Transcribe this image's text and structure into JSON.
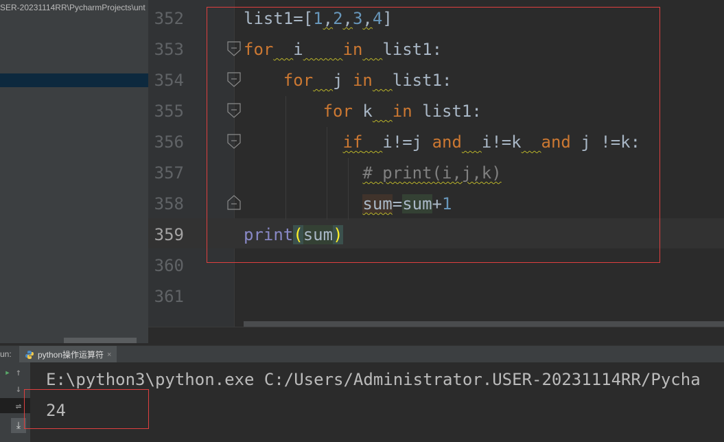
{
  "project": {
    "path": "SER-20231114RR\\PycharmProjects\\unt"
  },
  "editor": {
    "line_numbers": [
      "352",
      "353",
      "354",
      "355",
      "356",
      "357",
      "358",
      "359",
      "360",
      "361"
    ],
    "current_line": "359",
    "lines": [
      {
        "tokens": [
          [
            "list1=[",
            "ident"
          ],
          [
            "1",
            "num"
          ],
          [
            ",",
            "ident squig"
          ],
          [
            "2",
            "num"
          ],
          [
            ",",
            "ident squig"
          ],
          [
            "3",
            "num"
          ],
          [
            ",",
            "ident squig"
          ],
          [
            "4",
            "num"
          ],
          [
            "]",
            "ident"
          ]
        ]
      },
      {
        "tokens": [
          [
            "for",
            "kw"
          ],
          [
            "  ",
            "squig"
          ],
          [
            "i",
            "ident"
          ],
          [
            "    ",
            "squig"
          ],
          [
            "in",
            "kw"
          ],
          [
            "  ",
            "squig"
          ],
          [
            "list1:",
            "ident"
          ]
        ]
      },
      {
        "tokens": [
          [
            "    ",
            ""
          ],
          [
            "for",
            "kw"
          ],
          [
            "  ",
            "squig"
          ],
          [
            "j ",
            "ident"
          ],
          [
            "in",
            "kw"
          ],
          [
            "  ",
            "squig"
          ],
          [
            "list1:",
            "ident"
          ]
        ]
      },
      {
        "tokens": [
          [
            "        ",
            ""
          ],
          [
            "for",
            "kw"
          ],
          [
            " k",
            "ident"
          ],
          [
            "  ",
            "squig"
          ],
          [
            "in",
            "kw"
          ],
          [
            " list1:",
            "ident"
          ]
        ]
      },
      {
        "tokens": [
          [
            "          ",
            ""
          ],
          [
            "if",
            "kw squig"
          ],
          [
            "  ",
            "squig"
          ],
          [
            "i!=j ",
            "ident"
          ],
          [
            "and",
            "kw"
          ],
          [
            "  ",
            "squig"
          ],
          [
            "i!=k",
            "ident"
          ],
          [
            "  ",
            "squig"
          ],
          [
            "and",
            "kw"
          ],
          [
            " j !=k:",
            "ident"
          ]
        ]
      },
      {
        "tokens": [
          [
            "            ",
            ""
          ],
          [
            "# print(i,j,k)",
            "cmt squig"
          ]
        ]
      },
      {
        "tokens": [
          [
            "            ",
            ""
          ],
          [
            "sum",
            "ident squig hl-write"
          ],
          [
            "=",
            "ident"
          ],
          [
            "sum",
            "ident hl-read"
          ],
          [
            "+",
            "ident"
          ],
          [
            "1",
            "num"
          ]
        ]
      },
      {
        "tokens": [
          [
            "print",
            "builtin"
          ],
          [
            "(",
            "brace"
          ],
          [
            "sum",
            "ident hl-read"
          ],
          [
            ")",
            "brace"
          ]
        ]
      },
      {
        "tokens": []
      },
      {
        "tokens": []
      }
    ]
  },
  "run": {
    "label": "un:",
    "tab_title": "python操作运算符",
    "tab_close": "×",
    "console": [
      "E:\\python3\\python.exe C:/Users/Administrator.USER-20231114RR/Pycha",
      "24"
    ]
  },
  "icons": {
    "fold": "fold-marker-icon",
    "python": "python-icon",
    "run_up": "arrow-up-icon",
    "run_down": "arrow-down-icon",
    "wrap": "soft-wrap-icon",
    "scroll_end": "scroll-to-end-icon"
  },
  "colors": {
    "annotation": "#e04040",
    "keyword": "#cc7832",
    "number": "#6897bb"
  }
}
